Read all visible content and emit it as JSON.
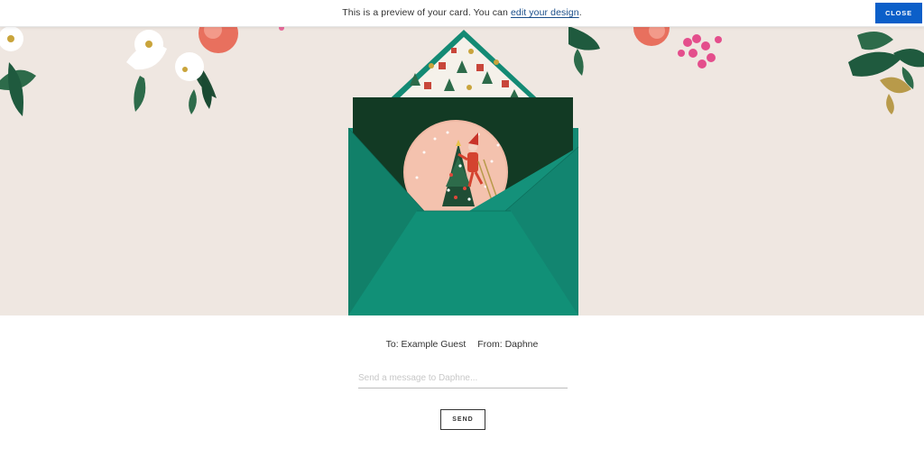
{
  "banner": {
    "text_before": "This is a preview of your card. You can ",
    "link_text": "edit your design",
    "text_after": ".",
    "close_label": "CLOSE"
  },
  "recipient": {
    "to": "To: Example Guest",
    "from": "From: Daphne"
  },
  "message": {
    "placeholder": "Send a message to Daphne...",
    "value": ""
  },
  "send_label": "SEND",
  "colors": {
    "accent_blue": "#0b5fc9",
    "envelope_green": "#138a74",
    "card_dark_green": "#123a24",
    "scene_background": "#efe7e1"
  }
}
